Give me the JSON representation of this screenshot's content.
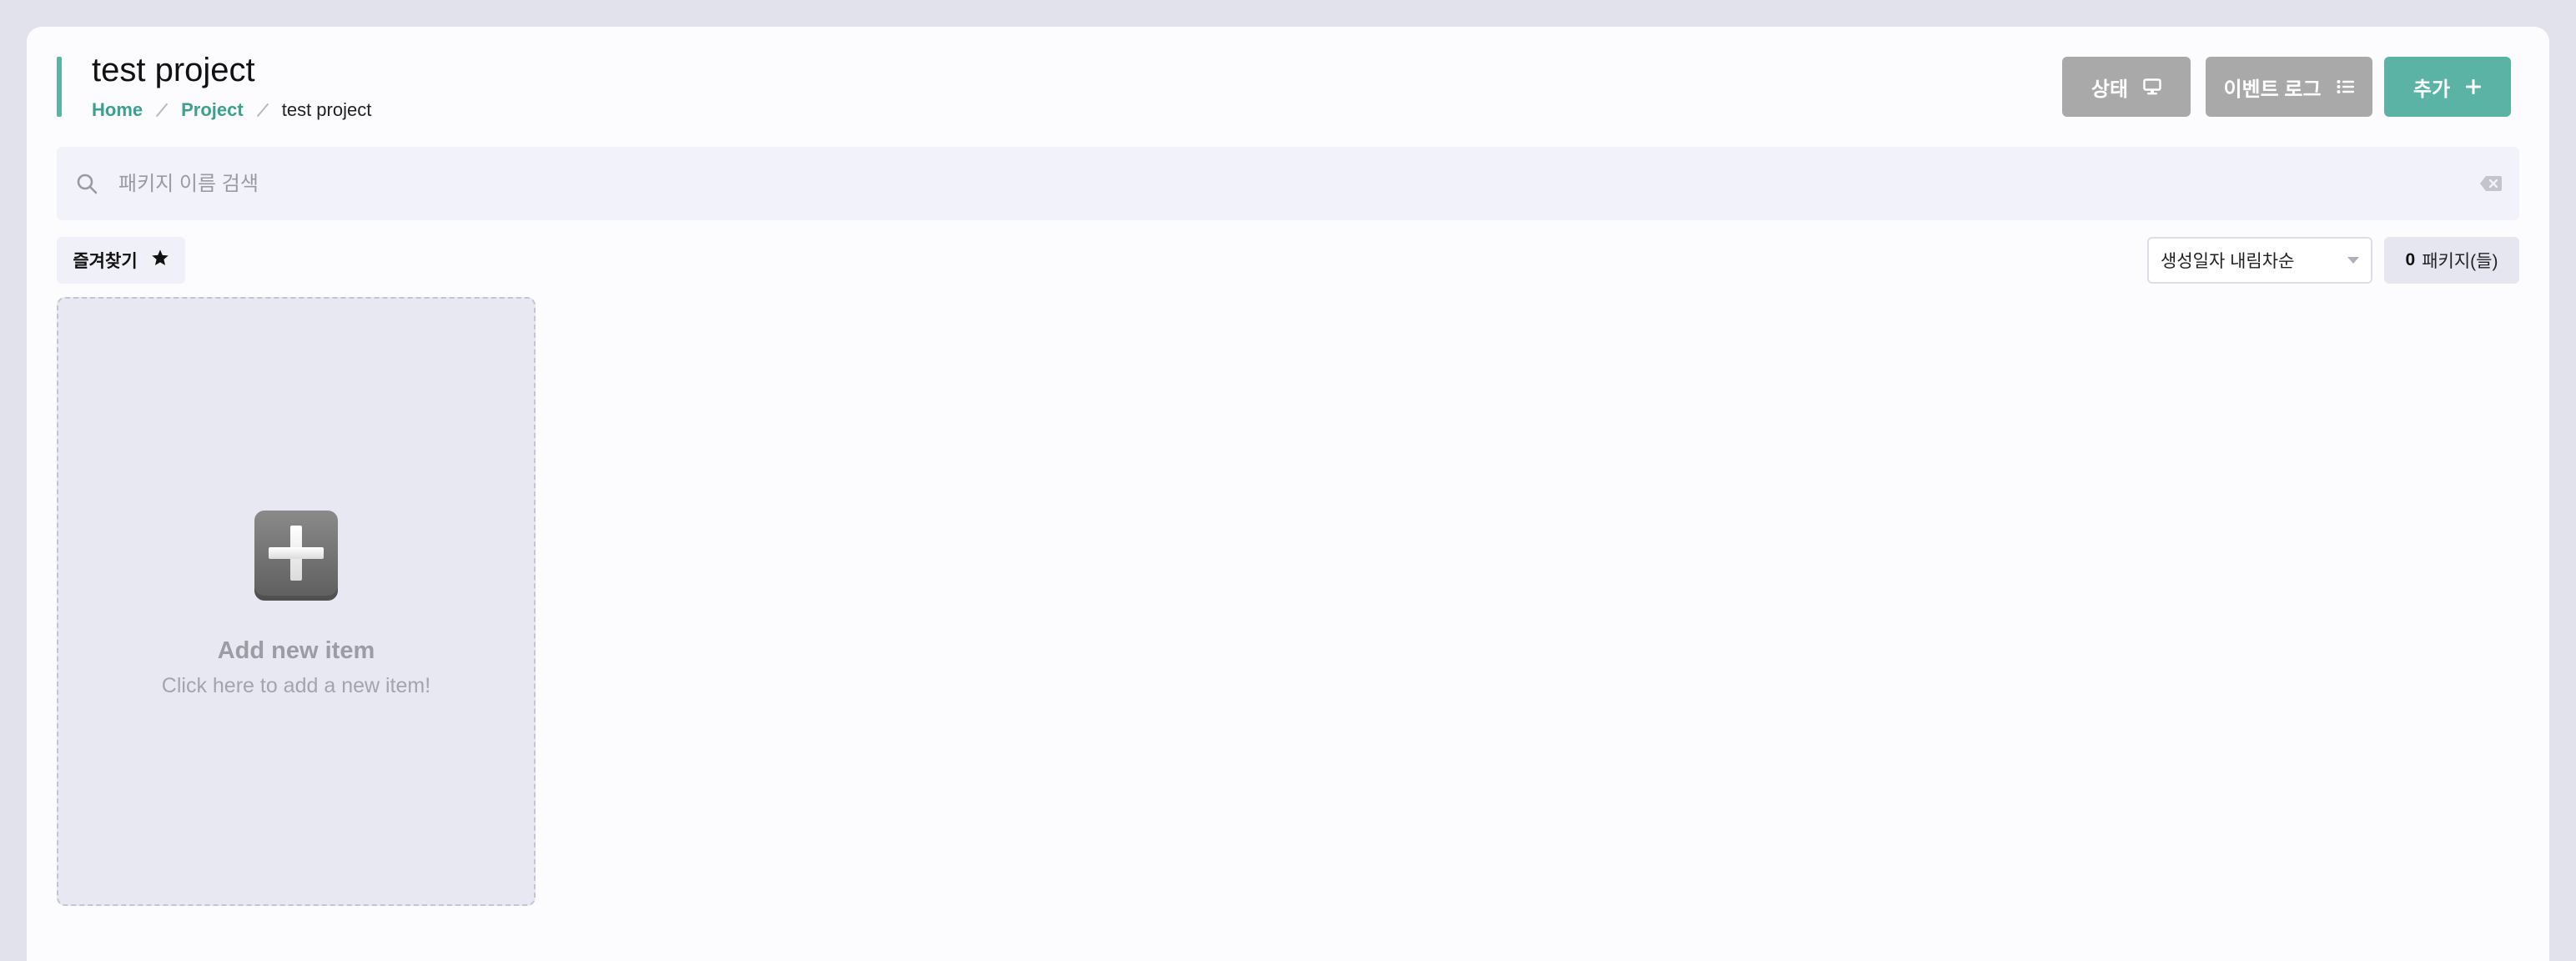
{
  "header": {
    "title": "test project",
    "breadcrumb": {
      "home": "Home",
      "project": "Project",
      "current": "test project"
    },
    "buttons": {
      "status": "상태",
      "event_log": "이벤트 로그",
      "add": "추가"
    }
  },
  "search": {
    "placeholder": "패키지 이름 검색",
    "value": ""
  },
  "toolbar": {
    "favorites_label": "즐겨찾기",
    "sort_selected": "생성일자 내림차순",
    "count_value": "0",
    "count_label": "패키지(들)"
  },
  "add_card": {
    "title": "Add new item",
    "subtitle": "Click here to add a new item!"
  },
  "colors": {
    "accent": "#5ab3a5",
    "button_gray": "#a9a9a9",
    "background": "#e2e2ec"
  },
  "icons": {
    "status": "monitor-icon",
    "event_log": "list-icon",
    "add": "plus-icon",
    "search": "search-icon",
    "clear": "backspace-clear-icon",
    "favorites": "star-icon",
    "card": "plus-tile-icon"
  }
}
